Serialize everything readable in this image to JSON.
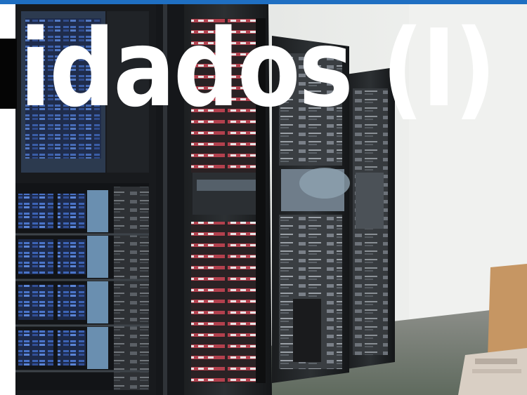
{
  "slide": {
    "title": "idados (I)",
    "accent_color": "#1f6fc2"
  },
  "photo": {
    "subject": "server-racks"
  }
}
